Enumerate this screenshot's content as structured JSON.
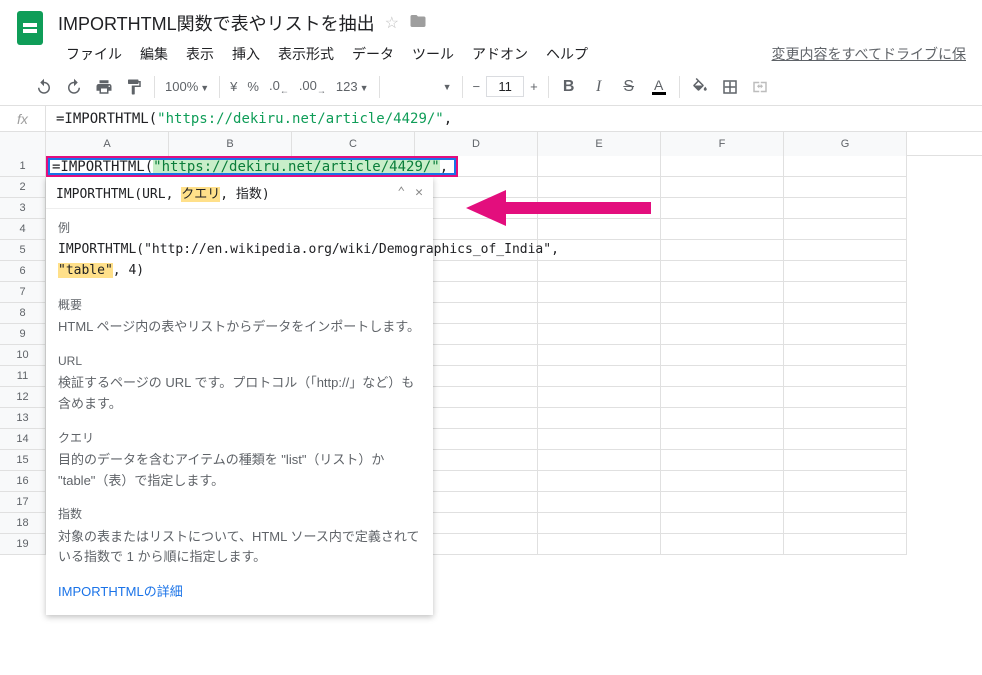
{
  "doc": {
    "title": "IMPORTHTML関数で表やリストを抽出",
    "save_status": "変更内容をすべてドライブに保"
  },
  "menu": {
    "file": "ファイル",
    "edit": "編集",
    "view": "表示",
    "insert": "挿入",
    "format": "表示形式",
    "data": "データ",
    "tools": "ツール",
    "addons": "アドオン",
    "help": "ヘルプ"
  },
  "toolbar": {
    "zoom": "100%",
    "currency": "¥",
    "percent": "%",
    "dec_dec": ".0",
    "inc_dec": ".00",
    "num_format": "123",
    "font_size": "11"
  },
  "formula": {
    "prefix": "=IMPORTHTML(",
    "string": "\"https://dekiru.net/article/4429/\"",
    "suffix": ","
  },
  "cell": {
    "prefix": "=IMPORTHTML(",
    "string": "\"https://dekiru.net/article/4429/\"",
    "suffix": ","
  },
  "columns": [
    "A",
    "B",
    "C",
    "D",
    "E",
    "F",
    "G"
  ],
  "rows": [
    1,
    2,
    3,
    4,
    5,
    6,
    7,
    8,
    9,
    10,
    11,
    12,
    13,
    14,
    15,
    16,
    17,
    18,
    19
  ],
  "help": {
    "sig_fn": "IMPORTHTML",
    "sig_open": "(URL, ",
    "sig_hl": "クエリ",
    "sig_rest": ", 指数)",
    "ex_title": "例",
    "ex_code_pre": "IMPORTHTML(\"http://en.wikipedia.org/wiki/Demographics_of_India\", ",
    "ex_code_hl": "\"table\"",
    "ex_code_post": ", 4)",
    "ov_title": "概要",
    "ov_text": "HTML ページ内の表やリストからデータをインポートします。",
    "url_title": "URL",
    "url_text": "検証するページの URL です。プロトコル（「http://」など）も含めます。",
    "q_title": "クエリ",
    "q_text": "目的のデータを含むアイテムの種類を \"list\"（リスト）か \"table\"（表）で指定します。",
    "idx_title": "指数",
    "idx_text": "対象の表またはリストについて、HTML ソース内で定義されている指数で 1 から順に指定します。",
    "link": "IMPORTHTMLの詳細"
  }
}
